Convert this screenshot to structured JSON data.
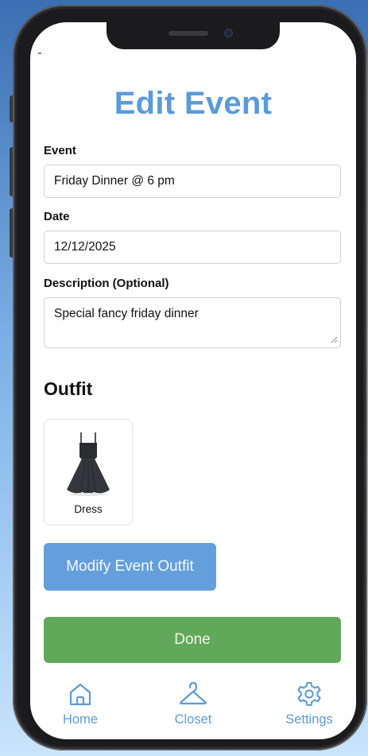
{
  "page": {
    "title": "Edit Event"
  },
  "form": {
    "event_label": "Event",
    "event_value": "Friday Dinner @ 6 pm",
    "date_label": "Date",
    "date_value": "12/12/2025",
    "description_label": "Description (Optional)",
    "description_value": "Special fancy friday dinner"
  },
  "outfit": {
    "heading": "Outfit",
    "items": [
      {
        "label": "Dress",
        "icon": "dress-icon"
      }
    ]
  },
  "buttons": {
    "modify_label": "Modify Event Outfit",
    "done_label": "Done"
  },
  "tabbar": {
    "items": [
      {
        "label": "Home",
        "icon": "home-icon"
      },
      {
        "label": "Closet",
        "icon": "hanger-icon"
      },
      {
        "label": "Settings",
        "icon": "gear-icon"
      }
    ]
  },
  "colors": {
    "accent_blue": "#5b9bd9",
    "modify_button": "#649fdc",
    "done_button": "#62a85a"
  }
}
